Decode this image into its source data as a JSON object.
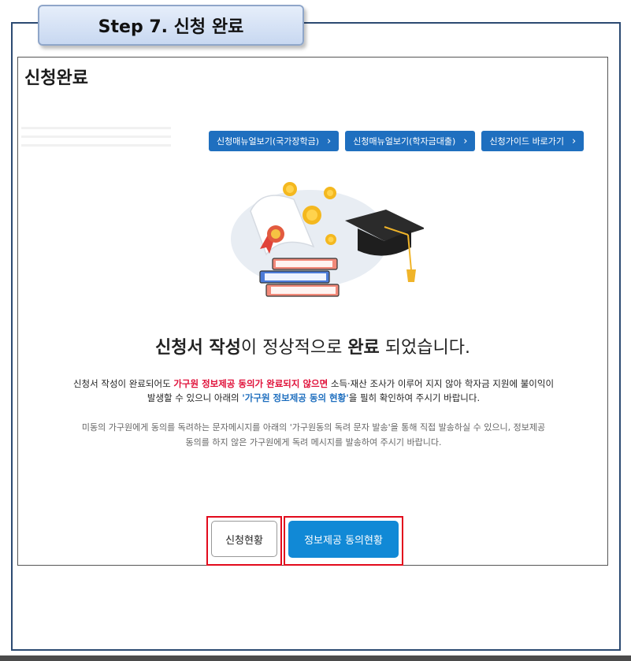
{
  "header": {
    "step_label": "Step 7. 신청 완료"
  },
  "panel": {
    "title": "신청완료"
  },
  "manual_buttons": [
    {
      "label": "신청매뉴얼보기(국가장학금)",
      "icon": "chevron-right-icon"
    },
    {
      "label": "신청매뉴얼보기(학자금대출)",
      "icon": "chevron-right-icon"
    },
    {
      "label": "신청가이드 바로가기",
      "icon": "chevron-right-icon"
    }
  ],
  "message": {
    "headline_bold1": "신청서 작성",
    "headline_text1": "이 정상적으로 ",
    "headline_bold2": "완료",
    "headline_text2": " 되었습니다.",
    "notice_part1": "신청서 작성이 완료되어도 ",
    "notice_red": "가구원 정보제공 동의가 완료되지 않으면",
    "notice_part2": " 소득·재산 조사가 이루어 지지 않아 학자금 지원에 불이익이",
    "notice_part3": "발생할 수 있으니 아래의 ",
    "notice_blue": "'가구원 정보제공 동의 현황'",
    "notice_part4": "을 필히 확인하여 주시기 바랍니다.",
    "sub_line1": "미동의 가구원에게 동의를 독려하는 문자메시지를 아래의 '가구원동의 독려 문자 발송'을 통해 직접 발송하실 수 있으니, 정보제공",
    "sub_line2": "동의를 하지 않은 가구원에게 독려 메시지를 발송하여 주시기 바랍니다."
  },
  "actions": {
    "status_label": "신청현황",
    "consent_label": "정보제공 동의현황"
  },
  "colors": {
    "manual_button_bg": "#1f6fbf",
    "consent_button_bg": "#1189d6",
    "highlight_red": "#e0113a",
    "frame_navy": "#2c4a72"
  }
}
